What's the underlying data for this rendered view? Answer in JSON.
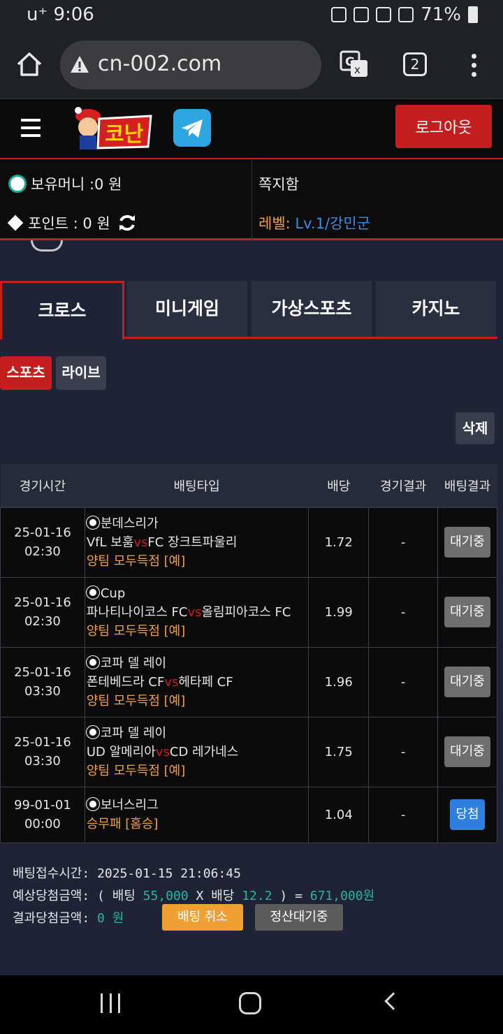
{
  "status_bar": {
    "carrier_time": "u⁺ 9:06",
    "battery": "71%"
  },
  "browser": {
    "url": "cn-002.com",
    "tab_count": "2"
  },
  "header": {
    "logout_label": "로그아웃"
  },
  "info": {
    "money_label": "보유머니 :0 원",
    "point_label": "포인트 :  0 원",
    "messages_label": "쪽지함",
    "level_label": "레벨:",
    "level_value": "Lv.1/강민군"
  },
  "category_tabs": [
    "크로스",
    "미니게임",
    "가상스포츠",
    "카지노"
  ],
  "sub_tabs": [
    "스포츠",
    "라이브"
  ],
  "delete_label": "삭제",
  "table": {
    "headers": [
      "경기시간",
      "배팅타입",
      "배당",
      "경기결과",
      "배팅결과"
    ],
    "rows": [
      {
        "date": "25-01-16",
        "time": "02:30",
        "league": "분데스리가",
        "home": "VfL 보훔",
        "away": "FC 장크트파울리",
        "pick": "양팀 모두득점 [예]",
        "odds": "1.72",
        "result": "-",
        "status": "대기중"
      },
      {
        "date": "25-01-16",
        "time": "02:30",
        "league": "Cup",
        "home": "파나티나이코스 FC",
        "away": "올림피아코스 FC",
        "pick": "양팀 모두득점 [예]",
        "odds": "1.99",
        "result": "-",
        "status": "대기중"
      },
      {
        "date": "25-01-16",
        "time": "03:30",
        "league": "코파 델 레이",
        "home": "폰테베드라 CF",
        "away": "헤타페 CF",
        "pick": "양팀 모두득점 [예]",
        "odds": "1.96",
        "result": "-",
        "status": "대기중"
      },
      {
        "date": "25-01-16",
        "time": "03:30",
        "league": "코파 델 레이",
        "home": "UD 알메리아",
        "away": "CD 레가네스",
        "pick": "양팀 모두득점 [예]",
        "odds": "1.75",
        "result": "-",
        "status": "대기중"
      },
      {
        "date": "99-01-01",
        "time": "00:00",
        "league": "보너스리그",
        "pick": "승무패 [홈승]",
        "odds": "1.04",
        "result": "-",
        "status": "당첨"
      }
    ],
    "vs_label": "vs"
  },
  "summary": {
    "bet_time_label": "배팅접수시간:",
    "bet_time": "2025-01-15 21:06:45",
    "expected_label": "예상당첨금액: ( 배팅",
    "stake": "55,000",
    "x_odds_label": "X 배당",
    "total_odds": "12.2",
    "equals": ") =",
    "expected_win": "671,000원",
    "result_label": "결과당첨금액:",
    "result_amount": "0 원",
    "cancel_label": "배팅 취소",
    "settle_label": "정산대기중"
  },
  "colors": {
    "accent_red": "#c41e1e",
    "teal": "#2bb59a",
    "orange": "#f0a040",
    "blue": "#2f7fe0"
  }
}
